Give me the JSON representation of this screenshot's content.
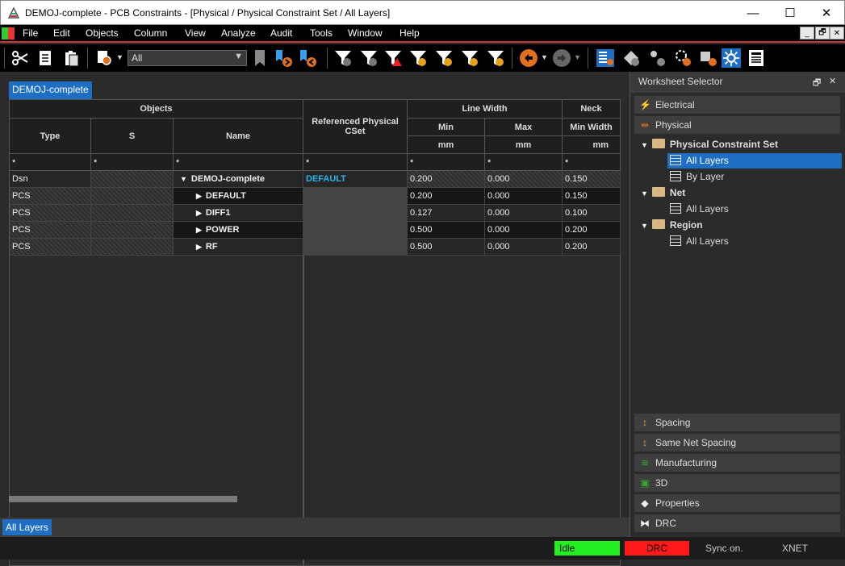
{
  "window": {
    "title": "DEMOJ-complete - PCB Constraints - [Physical / Physical Constraint Set / All Layers]",
    "minimize_glyph": "—",
    "maximize_glyph": "☐",
    "close_glyph": "✕"
  },
  "menu": [
    "File",
    "Edit",
    "Objects",
    "Column",
    "View",
    "Analyze",
    "Audit",
    "Tools",
    "Window",
    "Help"
  ],
  "mdi_controls": [
    "_",
    "🗗",
    "✕"
  ],
  "toolbar": {
    "filter_value": "All",
    "dropdown_glyph": "▼"
  },
  "document_tab": "DEMOJ-complete",
  "grid": {
    "group_headers": {
      "objects": "Objects",
      "referenced": "Referenced Physical CSet",
      "line_width": "Line Width",
      "neck": "Neck"
    },
    "col_headers": {
      "type": "Type",
      "s": "S",
      "name": "Name",
      "min": "Min",
      "max": "Max",
      "min_width": "Min Width"
    },
    "units": {
      "min": "mm",
      "max": "mm",
      "min_width": "mm"
    },
    "filter_glyph": "*",
    "rows": [
      {
        "type": "Dsn",
        "s": "",
        "name": "DEMOJ-complete",
        "ref": "DEFAULT",
        "min": "0.200",
        "max": "0.000",
        "neck": "0.150"
      },
      {
        "type": "PCS",
        "s": "",
        "name": "DEFAULT",
        "ref": "",
        "min": "0.200",
        "max": "0.000",
        "neck": "0.150"
      },
      {
        "type": "PCS",
        "s": "",
        "name": "DIFF1",
        "ref": "",
        "min": "0.127",
        "max": "0.000",
        "neck": "0.100"
      },
      {
        "type": "PCS",
        "s": "",
        "name": "POWER",
        "ref": "",
        "min": "0.500",
        "max": "0.000",
        "neck": "0.200"
      },
      {
        "type": "PCS",
        "s": "",
        "name": "RF",
        "ref": "",
        "min": "0.500",
        "max": "0.000",
        "neck": "0.200"
      }
    ]
  },
  "bottom_tab": "All Layers",
  "status": {
    "state": "Idle",
    "drc": "DRC",
    "sync": "Sync on.",
    "xnet": "XNET"
  },
  "worksheet": {
    "title": "Worksheet Selector",
    "restore_glyph": "🗗",
    "close_glyph": "✕",
    "sections_top": [
      "Electrical",
      "Physical"
    ],
    "tree": [
      {
        "label": "Physical Constraint Set",
        "children": [
          "All Layers",
          "By Layer"
        ]
      },
      {
        "label": "Net",
        "children": [
          "All Layers"
        ]
      },
      {
        "label": "Region",
        "children": [
          "All Layers"
        ]
      }
    ],
    "sections_bottom": [
      "Spacing",
      "Same Net Spacing",
      "Manufacturing",
      "3D",
      "Properties",
      "DRC"
    ]
  },
  "colors": {
    "accent": "#1e6fc4",
    "ref_text": "#29b6e8",
    "idle": "#22ee22",
    "drc": "#ff1a1a"
  }
}
